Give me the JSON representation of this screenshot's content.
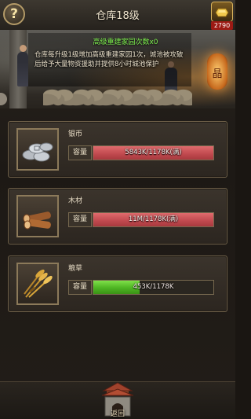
{
  "header": {
    "title": "仓库18级",
    "help_symbol": "?",
    "gold_count": "2790"
  },
  "banner": {
    "caption": "高级重建家园次数x0",
    "description": "仓库每升级1级增加高级重建家园1次，城池被攻破后给予大量物资援助并提供8小时城池保护",
    "lantern_glyph": "晶"
  },
  "resources": [
    {
      "name": "银币",
      "capacity_label": "容量",
      "value_text": "5843K/1178K(满)",
      "fill_fraction": 1.0,
      "status": "full",
      "bar_color": "#c24b50",
      "icon": "silver-coins-icon"
    },
    {
      "name": "木材",
      "capacity_label": "容量",
      "value_text": "11M/1178K(满)",
      "fill_fraction": 1.0,
      "status": "full",
      "bar_color": "#c24b50",
      "icon": "wood-logs-icon"
    },
    {
      "name": "粮草",
      "capacity_label": "容量",
      "value_text": "453K/1178K",
      "fill_fraction": 0.385,
      "status": "normal",
      "bar_color": "#4db423",
      "icon": "grain-bundle-icon"
    }
  ],
  "footer": {
    "back_label": "返回",
    "back_icon": "city-gate-icon"
  }
}
